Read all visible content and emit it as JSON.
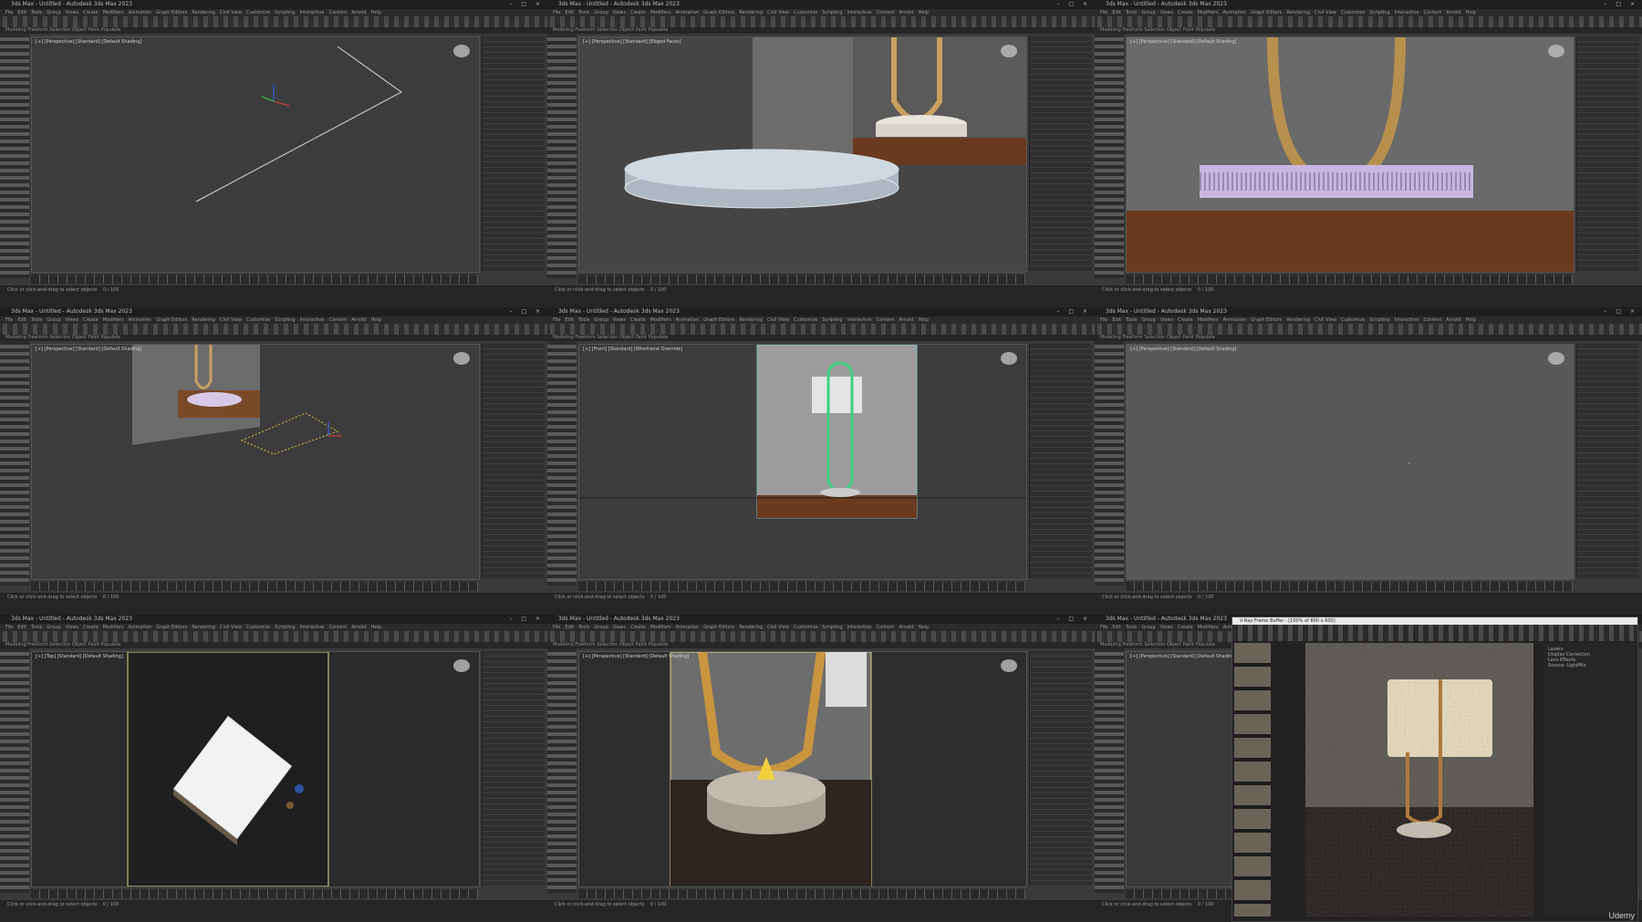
{
  "app": {
    "title": "3ds Max - Untitled - Autodesk 3ds Max 2023",
    "window_controls": "–  □  ×",
    "menus": [
      "File",
      "Edit",
      "Tools",
      "Group",
      "Views",
      "Create",
      "Modifiers",
      "Animation",
      "Graph Editors",
      "Rendering",
      "Civil View",
      "Customize",
      "Scripting",
      "Interactive",
      "Content",
      "Arnold",
      "Help"
    ],
    "ribbon": "Modeling   Freeform   Selection   Object Paint   Populate",
    "timeline_text": "0 / 100",
    "status_text": "Click or click-and-drag to select objects"
  },
  "panes": [
    {
      "viewport_label": "[+] [Perspective] [Standard] [Default Shading]",
      "colors": {
        "bg": "#3c3c3c"
      }
    },
    {
      "viewport_label": "[+] [Perspective] [Standard] [Edged Faces]",
      "colors": {
        "bg": "#454545"
      }
    },
    {
      "viewport_label": "[+] [Perspective] [Standard] [Default Shading]",
      "colors": {
        "bg": "#6a6a6a"
      }
    },
    {
      "viewport_label": "[+] [Perspective] [Standard] [Default Shading]",
      "colors": {
        "bg": "#3c3c3c"
      }
    },
    {
      "viewport_label": "[+] [Front] [Standard] [Wireframe Override]",
      "colors": {
        "bg": "#3c3c3c"
      }
    },
    {
      "viewport_label": "[+] [Perspective] [Standard] [Default Shading]",
      "colors": {
        "bg": "#545454"
      }
    },
    {
      "viewport_label": "[+] [Top] [Standard] [Default Shading]",
      "colors": {
        "bg": "#2b2b2b"
      }
    },
    {
      "viewport_label": "[+] [Perspective] [Standard] [Default Shading]",
      "colors": {
        "bg": "#2d2d2d"
      }
    },
    {
      "viewport_label": "[+] [Perspective] [Standard] [Default Shading]",
      "colors": {
        "bg": "#3a3a3a"
      }
    }
  ],
  "vfb": {
    "title": "V-Ray Frame Buffer - [100% of 800 x 600]",
    "layers_header": "Layers",
    "layers": [
      "Display Correction",
      "Lens Effects",
      "Source: LightMix"
    ]
  },
  "watermark": "Udemy"
}
